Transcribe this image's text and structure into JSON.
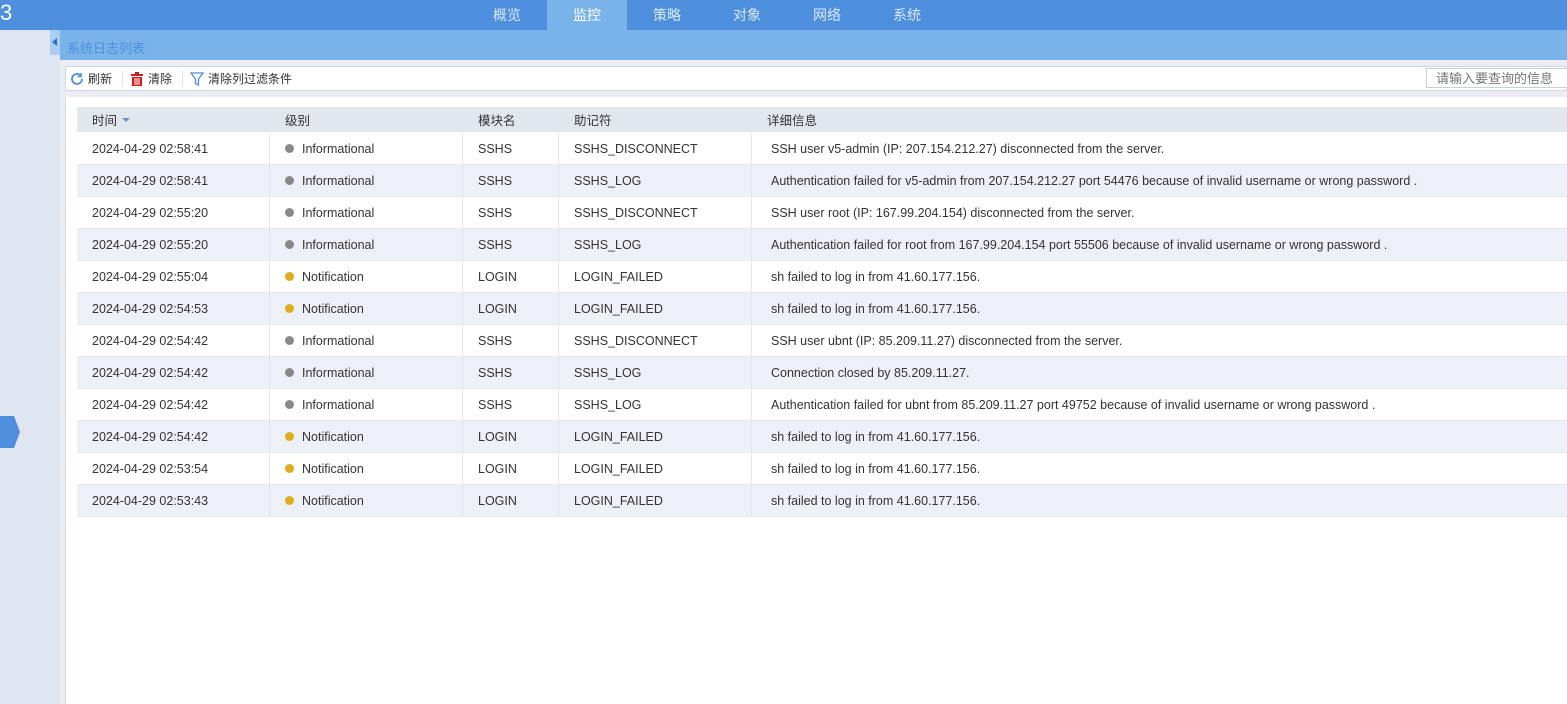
{
  "header": {
    "brand_fragment": "3",
    "tabs": [
      {
        "label": "概览"
      },
      {
        "label": "监控",
        "active": true
      },
      {
        "label": "策略"
      },
      {
        "label": "对象"
      },
      {
        "label": "网络"
      },
      {
        "label": "系统"
      }
    ]
  },
  "panel": {
    "title": "系统日志列表"
  },
  "toolbar": {
    "refresh": "刷新",
    "clear": "清除",
    "clear_filter": "清除列过滤条件",
    "search_placeholder": "请输入要查询的信息"
  },
  "colors": {
    "informational": "#888888",
    "notification": "#e0ac1a",
    "accent": "#4d8fdc"
  },
  "table": {
    "columns": [
      "时间",
      "级别",
      "模块名",
      "助记符",
      "详细信息"
    ],
    "rows": [
      [
        "2024-04-29 02:58:41",
        "Informational",
        "SSHS",
        "SSHS_DISCONNECT",
        "SSH user v5-admin (IP: 207.154.212.27) disconnected from the server."
      ],
      [
        "2024-04-29 02:58:41",
        "Informational",
        "SSHS",
        "SSHS_LOG",
        "Authentication failed for v5-admin from 207.154.212.27 port 54476 because of invalid username or wrong password ."
      ],
      [
        "2024-04-29 02:55:20",
        "Informational",
        "SSHS",
        "SSHS_DISCONNECT",
        "SSH user root (IP: 167.99.204.154) disconnected from the server."
      ],
      [
        "2024-04-29 02:55:20",
        "Informational",
        "SSHS",
        "SSHS_LOG",
        "Authentication failed for root from 167.99.204.154 port 55506 because of invalid username or wrong password ."
      ],
      [
        "2024-04-29 02:55:04",
        "Notification",
        "LOGIN",
        "LOGIN_FAILED",
        "sh failed to log in from 41.60.177.156."
      ],
      [
        "2024-04-29 02:54:53",
        "Notification",
        "LOGIN",
        "LOGIN_FAILED",
        "sh failed to log in from 41.60.177.156."
      ],
      [
        "2024-04-29 02:54:42",
        "Informational",
        "SSHS",
        "SSHS_DISCONNECT",
        "SSH user ubnt (IP: 85.209.11.27) disconnected from the server."
      ],
      [
        "2024-04-29 02:54:42",
        "Informational",
        "SSHS",
        "SSHS_LOG",
        "Connection closed by 85.209.11.27."
      ],
      [
        "2024-04-29 02:54:42",
        "Informational",
        "SSHS",
        "SSHS_LOG",
        "Authentication failed for ubnt from 85.209.11.27 port 49752 because of invalid username or wrong password ."
      ],
      [
        "2024-04-29 02:54:42",
        "Notification",
        "LOGIN",
        "LOGIN_FAILED",
        "sh failed to log in from 41.60.177.156."
      ],
      [
        "2024-04-29 02:53:54",
        "Notification",
        "LOGIN",
        "LOGIN_FAILED",
        "sh failed to log in from 41.60.177.156."
      ],
      [
        "2024-04-29 02:53:43",
        "Notification",
        "LOGIN",
        "LOGIN_FAILED",
        "sh failed to log in from 41.60.177.156."
      ]
    ]
  }
}
